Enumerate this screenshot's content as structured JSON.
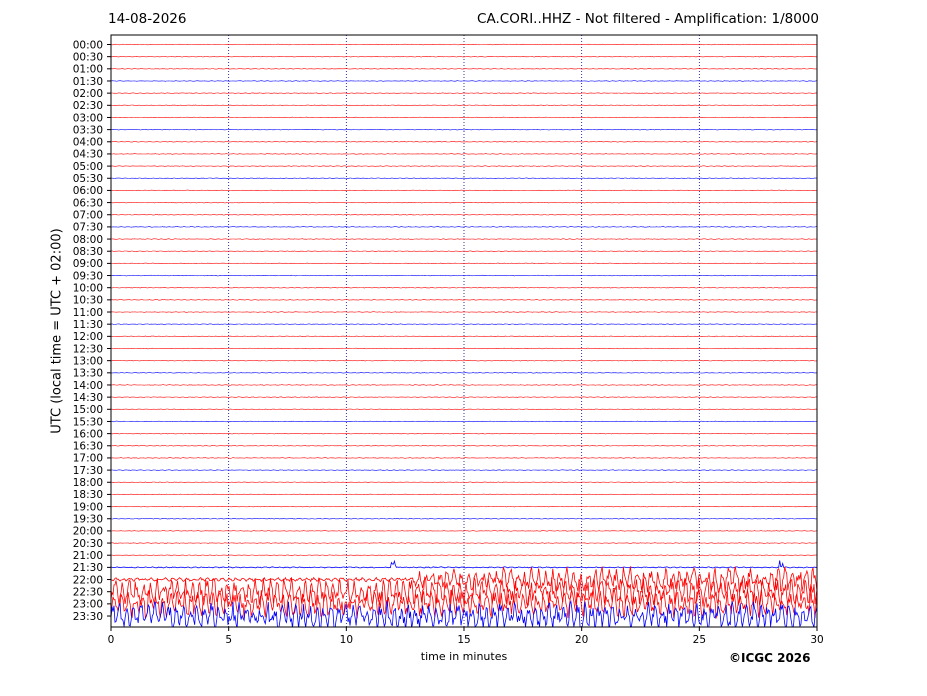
{
  "header": {
    "date": "14-08-2026",
    "title": "CA.CORI..HHZ - Not filtered - Amplification: 1/8000"
  },
  "footer": {
    "copyright": "©ICGC 2026"
  },
  "chart_data": {
    "type": "line",
    "title": "CA.CORI..HHZ - Not filtered - Amplification: 1/8000",
    "xlabel": "time in minutes",
    "ylabel": "UTC (local time = UTC + 02:00)",
    "xlim": [
      0,
      30
    ],
    "x_ticks": [
      "0",
      "5",
      "10",
      "15",
      "20",
      "25",
      "30"
    ],
    "y_ticks": [
      "00:00",
      "00:30",
      "01:00",
      "01:30",
      "02:00",
      "02:30",
      "03:00",
      "03:30",
      "04:00",
      "04:30",
      "05:00",
      "05:30",
      "06:00",
      "06:30",
      "07:00",
      "07:30",
      "08:00",
      "08:30",
      "09:00",
      "09:30",
      "10:00",
      "10:30",
      "11:00",
      "11:30",
      "12:00",
      "12:30",
      "13:00",
      "13:30",
      "14:00",
      "14:30",
      "15:00",
      "15:30",
      "16:00",
      "16:30",
      "17:00",
      "17:30",
      "18:00",
      "18:30",
      "19:00",
      "19:30",
      "20:00",
      "20:30",
      "21:00",
      "21:30",
      "22:00",
      "22:30",
      "23:00",
      "23:30"
    ],
    "trace_colors": [
      "#ff0000",
      "#0000ff"
    ],
    "trace_color_pattern": "red-red-red-blue repeating by row",
    "grid": "vertical dotted lines at x ticks",
    "quiet_rows": "00:00 to 21:30 (near-flat traces)",
    "active_rows": [
      {
        "row": "21:30",
        "level": "low, spikes near 12 and 28 min"
      },
      {
        "row": "22:00",
        "level": "high, increasing after 18 min"
      },
      {
        "row": "22:30",
        "level": "high"
      },
      {
        "row": "23:00",
        "level": "high"
      },
      {
        "row": "23:30",
        "level": "high"
      }
    ]
  }
}
